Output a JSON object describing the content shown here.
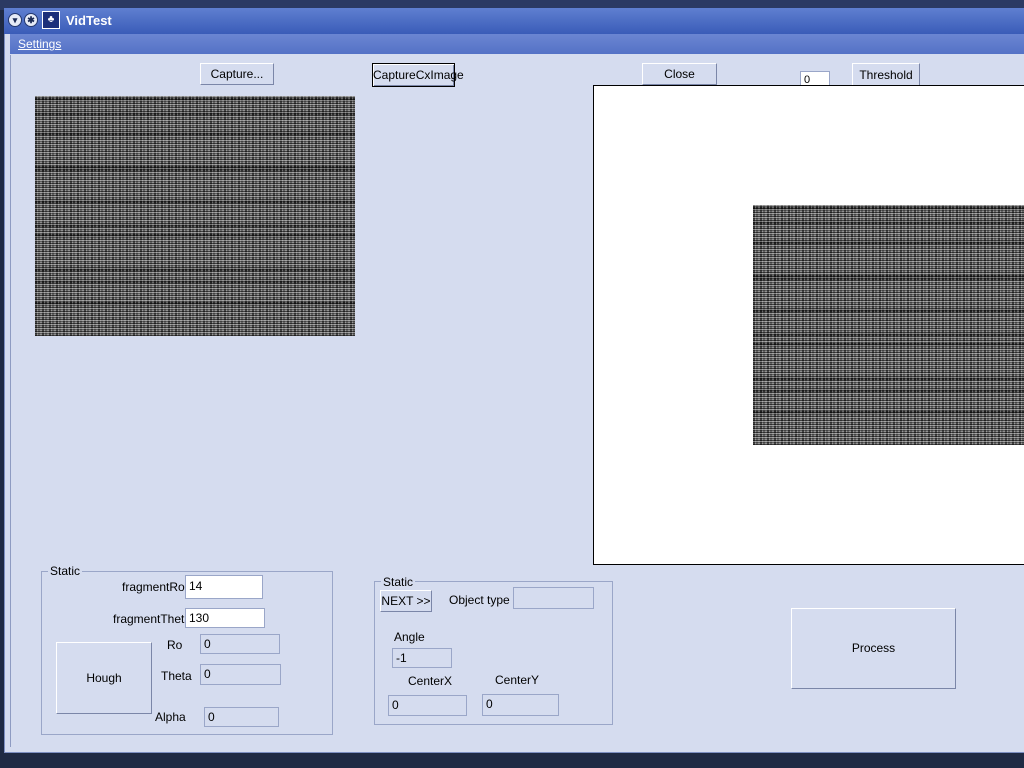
{
  "window": {
    "title": "VidTest"
  },
  "menu": {
    "settings": "Settings"
  },
  "toolbar": {
    "capture": "Capture...",
    "capture_cx": "CaptureCxImage",
    "close": "Close",
    "threshold_value": "0",
    "threshold": "Threshold"
  },
  "group_left": {
    "label": "Static",
    "fragment_ro_label": "fragmentRo",
    "fragment_ro_value": "14",
    "fragment_theta_label": "fragmentTheta",
    "fragment_theta_value": "130",
    "hough": "Hough",
    "ro_label": "Ro",
    "ro_value": "0",
    "theta_label": "Theta",
    "theta_value": "0",
    "alpha_label": "Alpha",
    "alpha_value": "0"
  },
  "group_mid": {
    "label": "Static",
    "next": "NEXT >>",
    "object_type_label": "Object type",
    "object_type_value": "",
    "angle_label": "Angle",
    "angle_value": "-1",
    "centerx_label": "CenterX",
    "centerx_value": "0",
    "centery_label": "CenterY",
    "centery_value": "0"
  },
  "process": "Process",
  "icons": {
    "title_btn1": "circle-arrow-icon",
    "title_btn2": "pin-icon",
    "app": "app-icon"
  }
}
